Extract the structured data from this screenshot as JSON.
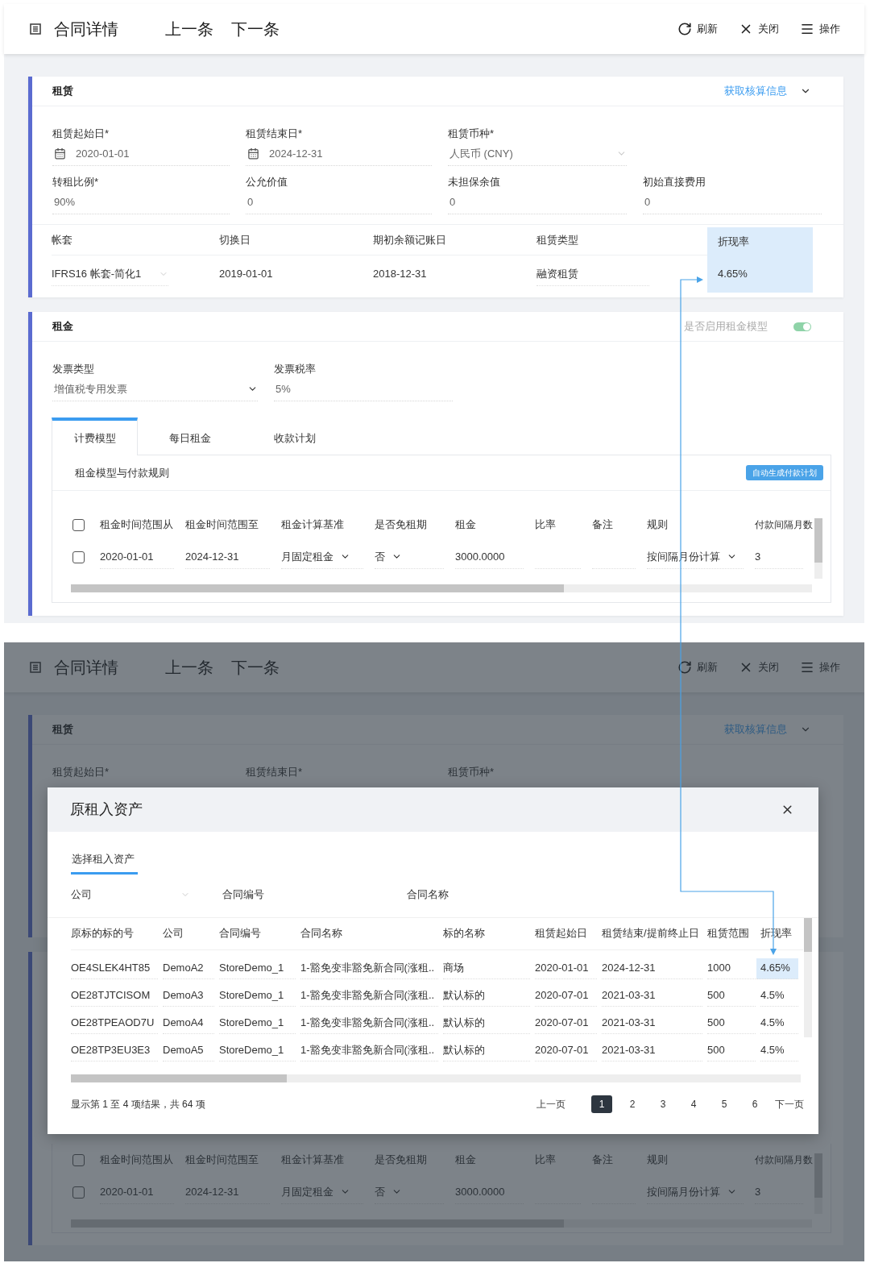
{
  "top_screen": {
    "header": {
      "title": "合同详情",
      "nav": [
        "上一条",
        "下一条"
      ],
      "actions": [
        {
          "kind": "refresh",
          "label": "刷新"
        },
        {
          "kind": "close",
          "label": "关闭"
        },
        {
          "kind": "menu",
          "label": "操作"
        }
      ]
    },
    "lease": {
      "title": "租赁",
      "link": "获取核算信息",
      "fields": [
        [
          {
            "label": "租赁起始日*",
            "value": "2020-01-01",
            "kind": "date"
          },
          {
            "label": "租赁结束日*",
            "value": "2024-12-31",
            "kind": "date"
          },
          {
            "label": "租赁币种*",
            "value": "人民币 (CNY)",
            "kind": "select"
          }
        ],
        [
          {
            "label": "转租比例*",
            "value": "90%",
            "kind": "text"
          },
          {
            "label": "公允价值",
            "value": "0",
            "kind": "text"
          },
          {
            "label": "未担保余值",
            "value": "0",
            "kind": "text"
          },
          {
            "label": "初始直接费用",
            "value": "0",
            "kind": "text"
          }
        ]
      ],
      "ledger": {
        "columns": [
          {
            "label": "帐套",
            "highlighted": false
          },
          {
            "label": "切换日",
            "highlighted": false
          },
          {
            "label": "期初余额记账日",
            "highlighted": false
          },
          {
            "label": "租赁类型",
            "highlighted": false
          },
          {
            "label": "折现率",
            "highlighted": true
          }
        ],
        "cells": [
          {
            "value": "IFRS16 帐套-简化1",
            "kind": "select"
          },
          {
            "value": "2019-01-01",
            "kind": "plain"
          },
          {
            "value": "2018-12-31",
            "kind": "plain"
          },
          {
            "value": "融资租赁",
            "kind": "underline"
          },
          {
            "value": "4.65%",
            "kind": "plain"
          }
        ]
      }
    },
    "rent": {
      "title": "租金",
      "toggle": {
        "label": "是否启用租金模型",
        "on": true
      },
      "fields": [
        {
          "label": "发票类型",
          "value": "增值税专用发票",
          "kind": "select"
        },
        {
          "label": "发票税率",
          "value": "5%",
          "kind": "text"
        }
      ],
      "tabs": [
        {
          "label": "计费模型",
          "selected": true
        },
        {
          "label": "每日租金",
          "selected": false
        },
        {
          "label": "收款计划",
          "selected": false
        }
      ],
      "panel_title": "租金模型与付款规则",
      "panel_button": "自动生成付款计划",
      "table": {
        "all_checked": false,
        "columns": [
          "租金时间范围从",
          "租金时间范围至",
          "租金计算基准",
          "是否免租期",
          "租金",
          "比率",
          "备注",
          "规则",
          "付款间隔月数"
        ],
        "rows": [
          {
            "checked": false,
            "cells": [
              {
                "kind": "text",
                "value": "2020-01-01"
              },
              {
                "kind": "text",
                "value": "2024-12-31"
              },
              {
                "kind": "select",
                "value": "月固定租金"
              },
              {
                "kind": "select",
                "value": "否"
              },
              {
                "kind": "text",
                "value": "3000.0000"
              },
              {
                "kind": "blank"
              },
              {
                "kind": "blank"
              },
              {
                "kind": "select",
                "value": "按间隔月份计算"
              },
              {
                "kind": "text",
                "value": "3"
              }
            ]
          }
        ]
      }
    }
  },
  "bottom_screen": {
    "header": {
      "title": "合同详情",
      "nav": [
        "上一条",
        "下一条"
      ],
      "actions": [
        {
          "kind": "refresh",
          "label": "刷新"
        },
        {
          "kind": "close",
          "label": "关闭"
        },
        {
          "kind": "menu",
          "label": "操作"
        }
      ]
    },
    "lease": {
      "title": "租赁",
      "link": "获取核算信息",
      "labels": [
        "租赁起始日*",
        "租赁结束日*",
        "租赁币种*"
      ]
    },
    "modal": {
      "title": "原租入资产",
      "tabs": [
        {
          "label": "选择租入资产",
          "selected": true
        }
      ],
      "filters": [
        {
          "label": "公司",
          "kind": "select"
        },
        {
          "label": "合同编号",
          "kind": "text"
        },
        {
          "label": "合同名称",
          "kind": "text"
        }
      ],
      "columns": [
        "原标的标的号",
        "公司",
        "合同编号",
        "合同名称",
        "标的名称",
        "租赁起始日",
        "租赁结束/提前终止日",
        "租赁范围",
        "折现率"
      ],
      "rows": [
        {
          "selected": true,
          "cells": [
            "OE4SLEK4HT85",
            "DemoA2",
            "StoreDemo_1",
            "1-豁免变非豁免新合同(涨租..",
            "商场",
            "2020-01-01",
            "2024-12-31",
            "1000",
            "4.65%"
          ]
        },
        {
          "selected": false,
          "cells": [
            "OE28TJTCISOM",
            "DemoA3",
            "StoreDemo_1",
            "1-豁免变非豁免新合同(涨租..",
            "默认标的",
            "2020-07-01",
            "2021-03-31",
            "500",
            "4.5%"
          ]
        },
        {
          "selected": false,
          "cells": [
            "OE28TPEAOD7U",
            "DemoA4",
            "StoreDemo_1",
            "1-豁免变非豁免新合同(涨租..",
            "默认标的",
            "2020-07-01",
            "2021-03-31",
            "500",
            "4.5%"
          ]
        },
        {
          "selected": false,
          "cells": [
            "OE28TP3EU3E3",
            "DemoA5",
            "StoreDemo_1",
            "1-豁免变非豁免新合同(涨租..",
            "默认标的",
            "2020-07-01",
            "2021-03-31",
            "500",
            "4.5%"
          ]
        }
      ],
      "summary": "显示第 1 至 4 项结果，共 64 项",
      "prev": "上一页",
      "pages": [
        {
          "label": "1",
          "selected": true
        },
        {
          "label": "2",
          "selected": false
        },
        {
          "label": "3",
          "selected": false
        },
        {
          "label": "4",
          "selected": false
        },
        {
          "label": "5",
          "selected": false
        },
        {
          "label": "6",
          "selected": false
        }
      ],
      "next": "下一页"
    },
    "rent_table": {
      "all_checked": false,
      "columns": [
        "租金时间范围从",
        "租金时间范围至",
        "租金计算基准",
        "是否免租期",
        "租金",
        "比率",
        "备注",
        "规则",
        "付款间隔月数"
      ],
      "rows": [
        {
          "checked": false,
          "cells": [
            {
              "kind": "text",
              "value": "2020-01-01"
            },
            {
              "kind": "text",
              "value": "2024-12-31"
            },
            {
              "kind": "select",
              "value": "月固定租金"
            },
            {
              "kind": "select",
              "value": "否"
            },
            {
              "kind": "text",
              "value": "3000.0000"
            },
            {
              "kind": "blank"
            },
            {
              "kind": "blank"
            },
            {
              "kind": "select",
              "value": "按间隔月份计算"
            },
            {
              "kind": "text",
              "value": "3"
            }
          ]
        }
      ]
    }
  }
}
